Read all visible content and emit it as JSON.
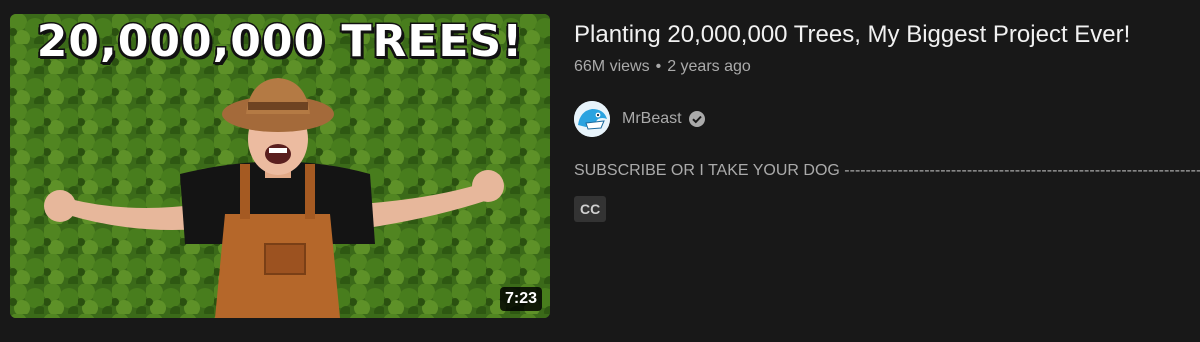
{
  "video": {
    "thumbnail_headline": "20,000,000 TREES!",
    "duration": "7:23",
    "title": "Planting 20,000,000 Trees, My Biggest Project Ever!",
    "views": "66M views",
    "separator": "•",
    "age": "2 years ago",
    "channel": "MrBeast",
    "description": "SUBSCRIBE OR I TAKE YOUR DOG ------------------------------------------------------------------- follow",
    "badge": "CC"
  },
  "icons": {
    "verified": "check-circle-icon",
    "avatar": "mrbeast-logo"
  },
  "colors": {
    "background": "#181818",
    "title": "#f1f1f1",
    "secondary_text": "#aaaaaa",
    "badge_bg": "#333333"
  }
}
